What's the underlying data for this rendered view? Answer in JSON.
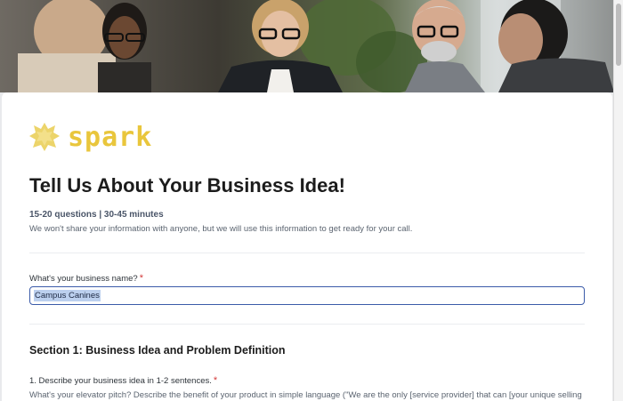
{
  "brand": {
    "name": "spark",
    "color": "#e9c63c"
  },
  "form": {
    "title": "Tell Us About Your Business Idea!",
    "meta": "15-20 questions | 30-45 minutes",
    "note": "We won't share your information with anyone, but we will use this information to get ready for your call."
  },
  "questions": {
    "business_name": {
      "label": "What's your business name?",
      "required": "*",
      "value": "Campus Canines"
    },
    "section1": {
      "title": "Section 1: Business Idea and Problem Definition"
    },
    "q1": {
      "label": "1. Describe your business idea in 1-2 sentences.",
      "required": "*",
      "help": "What's your elevator pitch? Describe the benefit of your product in simple language (\"We are the only [service provider] that can [your unique selling"
    }
  },
  "colors": {
    "accent": "#3b5ba9",
    "required": "#d33a3a",
    "selection": "#bcd0ee"
  }
}
